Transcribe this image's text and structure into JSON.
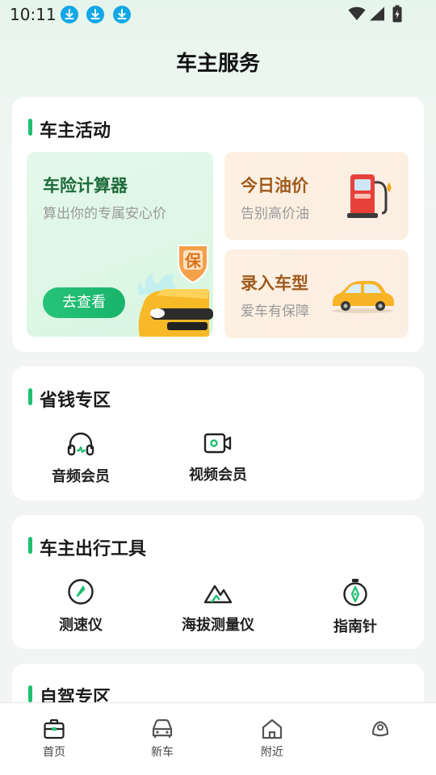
{
  "status_bar": {
    "time": "10:11"
  },
  "header": {
    "title": "车主服务"
  },
  "activity": {
    "title": "车主活动",
    "calculator": {
      "title": "车险计算器",
      "subtitle": "算出你的专属安心价",
      "button": "去查看",
      "badge": "保"
    },
    "oil": {
      "title": "今日油价",
      "subtitle": "告别高价油"
    },
    "car_model": {
      "title": "录入车型",
      "subtitle": "爱车有保障"
    }
  },
  "savings": {
    "title": "省钱专区",
    "items": [
      {
        "label": "音频会员",
        "icon": "headphones-icon"
      },
      {
        "label": "视频会员",
        "icon": "video-icon"
      }
    ]
  },
  "tools": {
    "title": "车主出行工具",
    "items": [
      {
        "label": "测速仪",
        "icon": "speedometer-icon"
      },
      {
        "label": "海拔测量仪",
        "icon": "mountain-icon"
      },
      {
        "label": "指南针",
        "icon": "compass-icon"
      }
    ]
  },
  "self_drive": {
    "title": "自驾专区"
  },
  "nav": {
    "items": [
      {
        "label": "首页",
        "icon": "briefcase-icon"
      },
      {
        "label": "新车",
        "icon": "car-icon"
      },
      {
        "label": "附近",
        "icon": "home-icon"
      },
      {
        "label": "",
        "icon": "profile-icon"
      }
    ]
  },
  "colors": {
    "accent": "#1fbf6e",
    "download_badge": "#12a7e6",
    "warm_title": "#a05a1c",
    "green_title": "#1f6b3b"
  }
}
